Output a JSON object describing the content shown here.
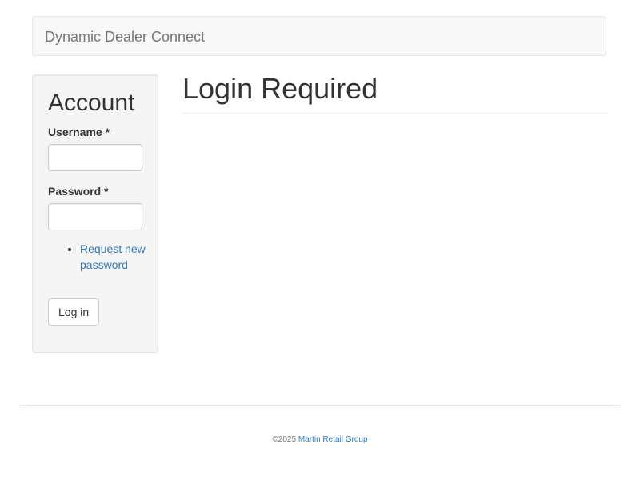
{
  "navbar": {
    "brand": "Dynamic Dealer Connect"
  },
  "sidebar": {
    "title": "Account",
    "username_label": "Username",
    "password_label": "Password",
    "required_marker": "*",
    "username_value": "",
    "password_value": "",
    "links": [
      {
        "label": "Request new password"
      }
    ],
    "login_button": "Log in"
  },
  "main": {
    "page_title": "Login Required"
  },
  "footer": {
    "copyright": "©2025",
    "company_link": "Martin Retail Group"
  },
  "colors": {
    "link": "#337ab7",
    "navbar_bg": "#f8f8f8",
    "well_bg": "#f5f5f5",
    "text": "#333333"
  }
}
